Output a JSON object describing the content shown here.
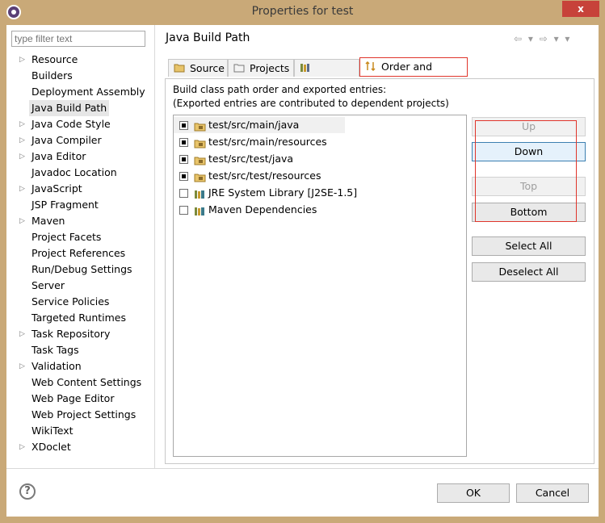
{
  "window": {
    "title": "Properties for test",
    "close_label": "x"
  },
  "filter": {
    "placeholder": "type filter text"
  },
  "tree": [
    {
      "label": "Resource",
      "expandable": true
    },
    {
      "label": "Builders",
      "expandable": false
    },
    {
      "label": "Deployment Assembly",
      "expandable": false
    },
    {
      "label": "Java Build Path",
      "expandable": false,
      "selected": true
    },
    {
      "label": "Java Code Style",
      "expandable": true
    },
    {
      "label": "Java Compiler",
      "expandable": true
    },
    {
      "label": "Java Editor",
      "expandable": true
    },
    {
      "label": "Javadoc Location",
      "expandable": false
    },
    {
      "label": "JavaScript",
      "expandable": true
    },
    {
      "label": "JSP Fragment",
      "expandable": false
    },
    {
      "label": "Maven",
      "expandable": true
    },
    {
      "label": "Project Facets",
      "expandable": false
    },
    {
      "label": "Project References",
      "expandable": false
    },
    {
      "label": "Run/Debug Settings",
      "expandable": false
    },
    {
      "label": "Server",
      "expandable": false
    },
    {
      "label": "Service Policies",
      "expandable": false
    },
    {
      "label": "Targeted Runtimes",
      "expandable": false
    },
    {
      "label": "Task Repository",
      "expandable": true
    },
    {
      "label": "Task Tags",
      "expandable": false
    },
    {
      "label": "Validation",
      "expandable": true
    },
    {
      "label": "Web Content Settings",
      "expandable": false
    },
    {
      "label": "Web Page Editor",
      "expandable": false
    },
    {
      "label": "Web Project Settings",
      "expandable": false
    },
    {
      "label": "WikiText",
      "expandable": false
    },
    {
      "label": "XDoclet",
      "expandable": true
    }
  ],
  "page": {
    "heading": "Java Build Path",
    "nav": "⇦ ▾ ⇨ ▾ ▾"
  },
  "tabs": [
    {
      "label": "Source",
      "icon": "source-folder-icon"
    },
    {
      "label": "Projects",
      "icon": "projects-icon"
    },
    {
      "label": "Libraries",
      "icon": "libraries-icon"
    },
    {
      "label": "Order and Export",
      "icon": "order-export-icon",
      "active": true
    }
  ],
  "description": {
    "line1": "Build class path order and exported entries:",
    "line2": "(Exported entries are contributed to dependent projects)"
  },
  "entries": [
    {
      "label": "test/src/main/java",
      "checked": true,
      "icon": "package-folder-icon"
    },
    {
      "label": "test/src/main/resources",
      "checked": true,
      "icon": "package-folder-icon"
    },
    {
      "label": "test/src/test/java",
      "checked": true,
      "icon": "package-folder-icon"
    },
    {
      "label": "test/src/test/resources",
      "checked": true,
      "icon": "package-folder-icon"
    },
    {
      "label": "JRE System Library [J2SE-1.5]",
      "checked": false,
      "icon": "library-icon"
    },
    {
      "label": "Maven Dependencies",
      "checked": false,
      "icon": "library-icon"
    }
  ],
  "buttons": {
    "up": "Up",
    "down": "Down",
    "top": "Top",
    "bottom": "Bottom",
    "select_all": "Select All",
    "deselect_all": "Deselect All"
  },
  "footer": {
    "help": "?",
    "ok": "OK",
    "cancel": "Cancel"
  }
}
